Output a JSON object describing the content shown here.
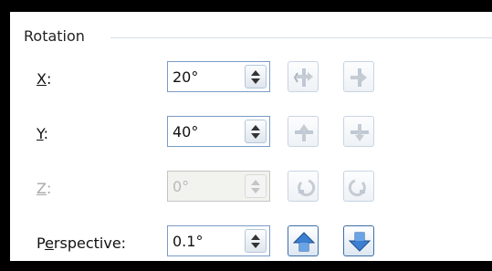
{
  "group": {
    "title": "Rotation"
  },
  "rows": [
    {
      "label_pre": "",
      "label_key": "X",
      "label_post": ":",
      "value": "20°"
    },
    {
      "label_pre": "",
      "label_key": "Y",
      "label_post": ":",
      "value": "40°"
    },
    {
      "label_pre": "",
      "label_key": "Z",
      "label_post": ":",
      "value": "0°"
    },
    {
      "label_pre": "P",
      "label_key": "e",
      "label_post": "rspective:",
      "value": "0.1°"
    }
  ],
  "icons": {
    "x_left": "rotate-x-left-icon",
    "x_right": "rotate-x-right-icon",
    "y_up": "rotate-y-up-icon",
    "y_down": "rotate-y-down-icon",
    "z_left": "rotate-z-counterclockwise-icon",
    "z_right": "rotate-z-clockwise-icon",
    "p_up": "perspective-increase-icon",
    "p_down": "perspective-decrease-icon"
  },
  "colors": {
    "accent": "#3d7fd1",
    "disabled_text": "#a8a8a8",
    "border": "#7a9cc6"
  }
}
